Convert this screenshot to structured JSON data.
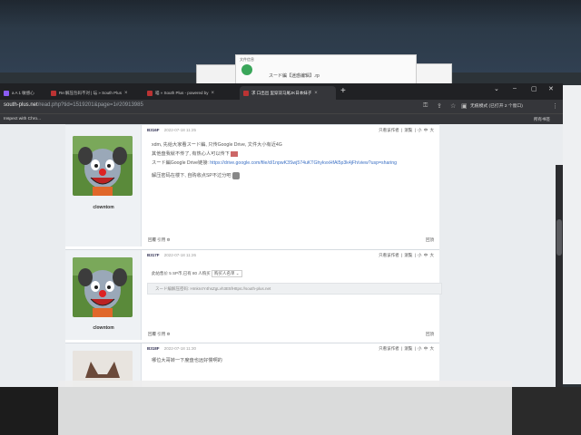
{
  "tabs": [
    {
      "label": "紫色酸菜与香精 | Pixiv"
    },
    {
      "label": "[r] kabisa · eleanorjeannele"
    },
    {
      "label": "a A 1 敏感心"
    },
    {
      "label": "Re:解压包码不对 | 坛 » South Plus"
    },
    {
      "label": "喵 » South Plus - powered by"
    },
    {
      "label": "求 口出出 里穿双马尾JK日本妹子"
    }
  ],
  "address": {
    "host": "south-plus.net",
    "path": "/read.php?tid=1519201&page=1#20913985"
  },
  "profile_label": "无痕模式 (已打开 2 个窗口)",
  "bookmarks": {
    "inspect": "Inspect with Chro...",
    "all": "所有书签"
  },
  "bg_window": {
    "title": "文件信息",
    "text": "スード編【迷惑编辑】.rp"
  },
  "posts": [
    {
      "floor": "B316F",
      "date": "2022-07-18 11:25",
      "head_links": "只看该作者 | 瀏覧 | 小 中 大",
      "author": "clowntom",
      "lines": [
        "xdm, 先给大家看スード編, 只传Google Drive, 文件大小有近4G",
        "其他盘我就不传了, 有热心人可以传下"
      ],
      "link_label": "スード編Google Drive链接:",
      "link_url": "https://drive.google.com/file/d/1npwK3Swj574uKTGhykvxHfAl5p3k4jFh/view?usp=sharing",
      "note": "解压密码在楼下, 自购收点SP不过分吧",
      "foot_left": "回覆  引用",
      "foot_right": "回頂"
    },
    {
      "floor": "B317F",
      "date": "2022-07-18 11:26",
      "head_links": "只看该作者 | 瀏覧 | 小 中 大",
      "author": "clowntom",
      "sell": "此帖售价 5 SP币,已有 80 人购买",
      "sell_select": "购买人名单",
      "hidden": "スード編解压密码:  Hmkn4Y4hsZgLvh3E5fHttps://south-plus.net",
      "foot_left": "回覆  引用",
      "foot_right": "回頂"
    },
    {
      "floor": "B318F",
      "date": "2022-07-18 11:30",
      "head_links": "只看该作者 | 瀏覧 | 小 中 大",
      "text": "哪位大哥转一下度盘也远好慢啊的"
    }
  ]
}
